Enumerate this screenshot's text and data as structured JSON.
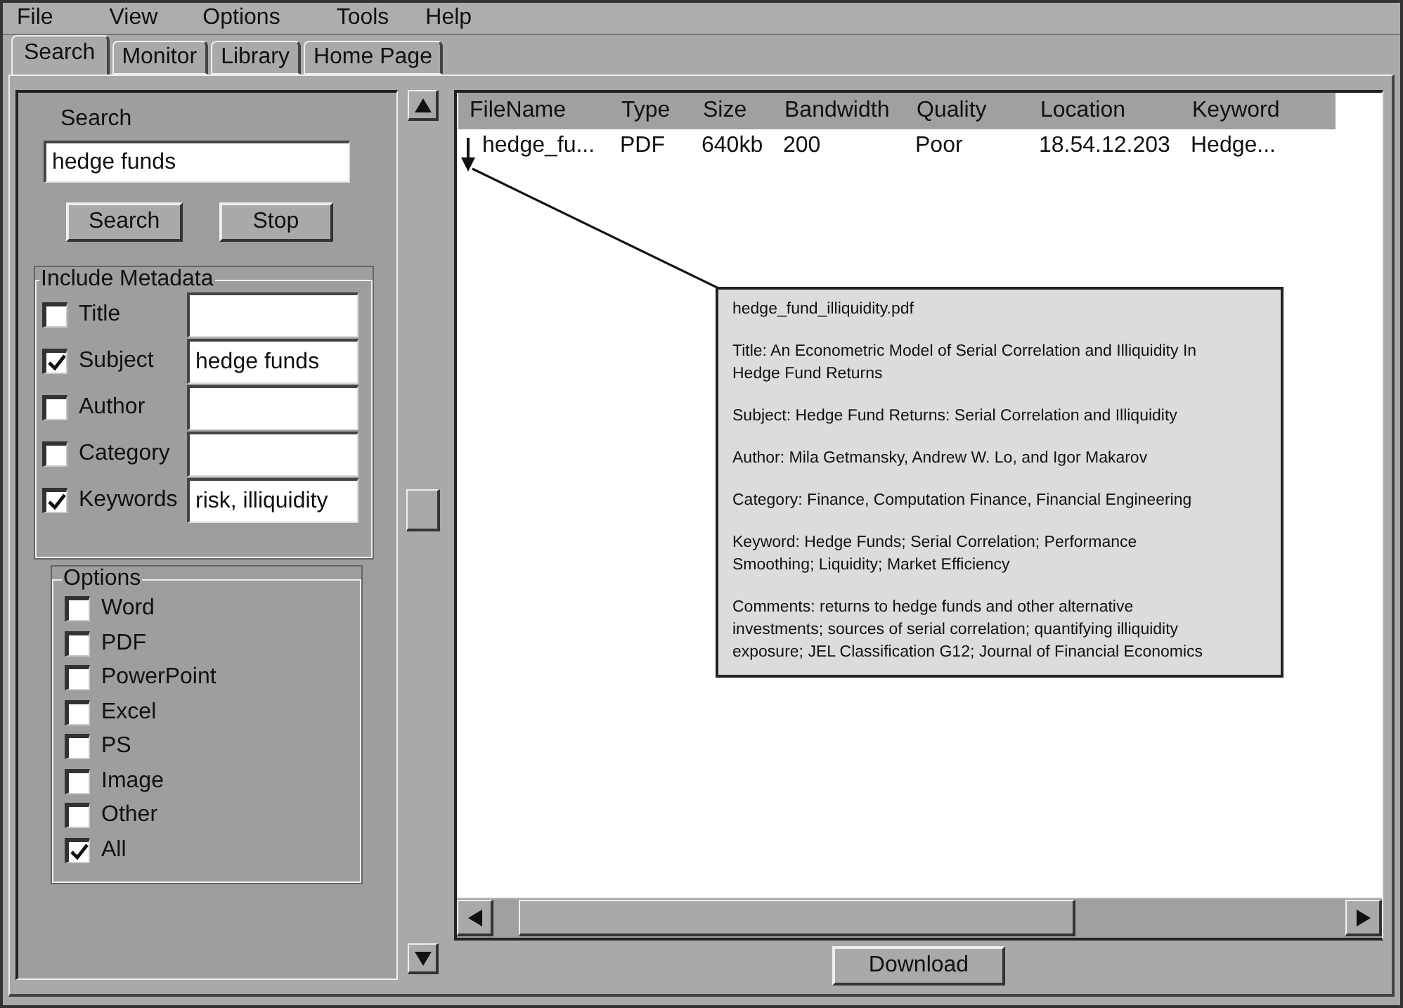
{
  "menu": [
    "File",
    "View",
    "Options",
    "Tools",
    "Help"
  ],
  "tabs": [
    {
      "label": "Search",
      "selected": true
    },
    {
      "label": "Monitor",
      "selected": false
    },
    {
      "label": "Library",
      "selected": false
    },
    {
      "label": "Home Page",
      "selected": false
    }
  ],
  "search": {
    "label": "Search",
    "value": "hedge funds",
    "buttons": [
      "Search",
      "Stop"
    ]
  },
  "metadata": {
    "label": "Include Metadata",
    "fields": [
      {
        "label": "Title",
        "checked": false
      },
      {
        "label": "Subject",
        "checked": true,
        "value": "hedge funds"
      },
      {
        "label": "Author",
        "checked": false
      },
      {
        "label": "Category",
        "checked": false
      },
      {
        "label": "Keywords",
        "checked": true,
        "value": "risk, illiquidity"
      }
    ]
  },
  "options": {
    "label": "Options",
    "items": [
      {
        "label": "Word",
        "checked": false
      },
      {
        "label": "PDF",
        "checked": false
      },
      {
        "label": "PowerPoint",
        "checked": false
      },
      {
        "label": "Excel",
        "checked": false
      },
      {
        "label": "PS",
        "checked": false
      },
      {
        "label": "Image",
        "checked": false
      },
      {
        "label": "Other",
        "checked": false
      },
      {
        "label": "All",
        "checked": true
      }
    ]
  },
  "results": {
    "columns": [
      "FileName",
      "Type",
      "Size",
      "Bandwidth",
      "Quality",
      "Location",
      "Keyword"
    ],
    "rows": [
      {
        "cells": [
          "hedge_fu...",
          "PDF",
          "640kb",
          "200",
          "Poor",
          "18.54.12.203",
          "Hedge..."
        ]
      }
    ]
  },
  "tooltip": {
    "lines": [
      "hedge_fund_illiquidity.pdf",
      "Title: An Econometric Model of Serial Correlation and Illiquidity In Hedge Fund Returns",
      "Subject: Hedge Fund Returns: Serial Correlation and Illiquidity",
      "Author: Mila Getmansky, Andrew W. Lo, and Igor Makarov",
      "Category: Finance, Computation Finance, Financial Engineering",
      "Keyword: Hedge Funds; Serial Correlation; Performance Smoothing; Liquidity; Market Efficiency",
      "Comments: returns to hedge funds and other alternative investments; sources of serial correlation; quantifying illiquidity exposure; JEL Classification G12; Journal of Financial Economics"
    ]
  },
  "download_button": "Download"
}
